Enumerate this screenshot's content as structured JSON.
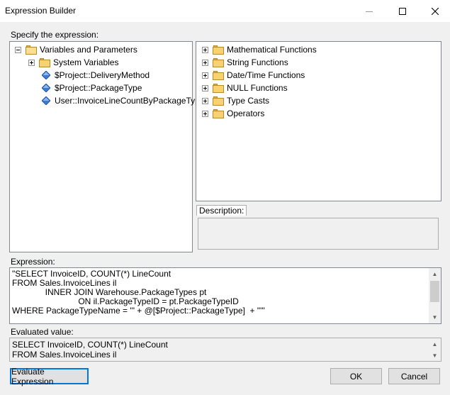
{
  "window": {
    "title": "Expression Builder"
  },
  "labels": {
    "specify": "Specify the expression:",
    "description": "Description:",
    "expression": "Expression:",
    "evaluated": "Evaluated value:"
  },
  "variables_tree": {
    "root": "Variables and Parameters",
    "items": [
      "System Variables",
      "$Project::DeliveryMethod",
      "$Project::PackageType",
      "User::InvoiceLineCountByPackageType"
    ]
  },
  "functions_tree": {
    "items": [
      "Mathematical Functions",
      "String Functions",
      "Date/Time Functions",
      "NULL Functions",
      "Type Casts",
      "Operators"
    ]
  },
  "expression": {
    "lines": [
      "\"SELECT InvoiceID, COUNT(*) LineCount",
      "FROM Sales.InvoiceLines il",
      "              INNER JOIN Warehouse.PackageTypes pt",
      "                            ON il.PackageTypeID = pt.PackageTypeID",
      "WHERE PackageTypeName = '\" + @[$Project::PackageType]  + \"'\""
    ]
  },
  "evaluated": {
    "lines": [
      "SELECT InvoiceID, COUNT(*) LineCount",
      "FROM Sales.InvoiceLines il"
    ]
  },
  "buttons": {
    "evaluate": "Evaluate Expression",
    "ok": "OK",
    "cancel": "Cancel"
  },
  "icons": {
    "minimize": "minimize-icon",
    "maximize": "maximize-icon",
    "close": "close-icon",
    "folder": "folder-icon",
    "variable": "variable-icon",
    "expand": "expand-icon",
    "collapse": "collapse-icon"
  },
  "colors": {
    "accent": "#0078d7",
    "variable_icon": "#3b7bd4",
    "folder": "#f7d26e"
  }
}
